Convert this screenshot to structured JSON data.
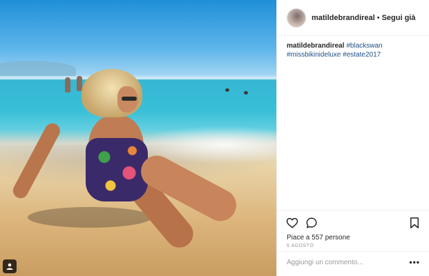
{
  "post": {
    "username": "matildebrandireal",
    "separator": "•",
    "follow_status": "Segui già",
    "caption": {
      "username": "matildebrandireal",
      "hashtags": [
        "#blackswan",
        "#missbikinideluxe",
        "#estate2017"
      ]
    },
    "likes_text": "Piace a 557 persone",
    "date": "6 AGOSTO",
    "comment_placeholder": "Aggiungi un commento...",
    "more_label": "•••"
  },
  "icons": {
    "like": "heart-icon",
    "comment": "comment-bubble-icon",
    "save": "bookmark-icon",
    "tagged_user": "user-tag-icon"
  },
  "colors": {
    "hashtag": "#1c4f86",
    "divider": "#efefef",
    "muted_text": "#999999"
  }
}
